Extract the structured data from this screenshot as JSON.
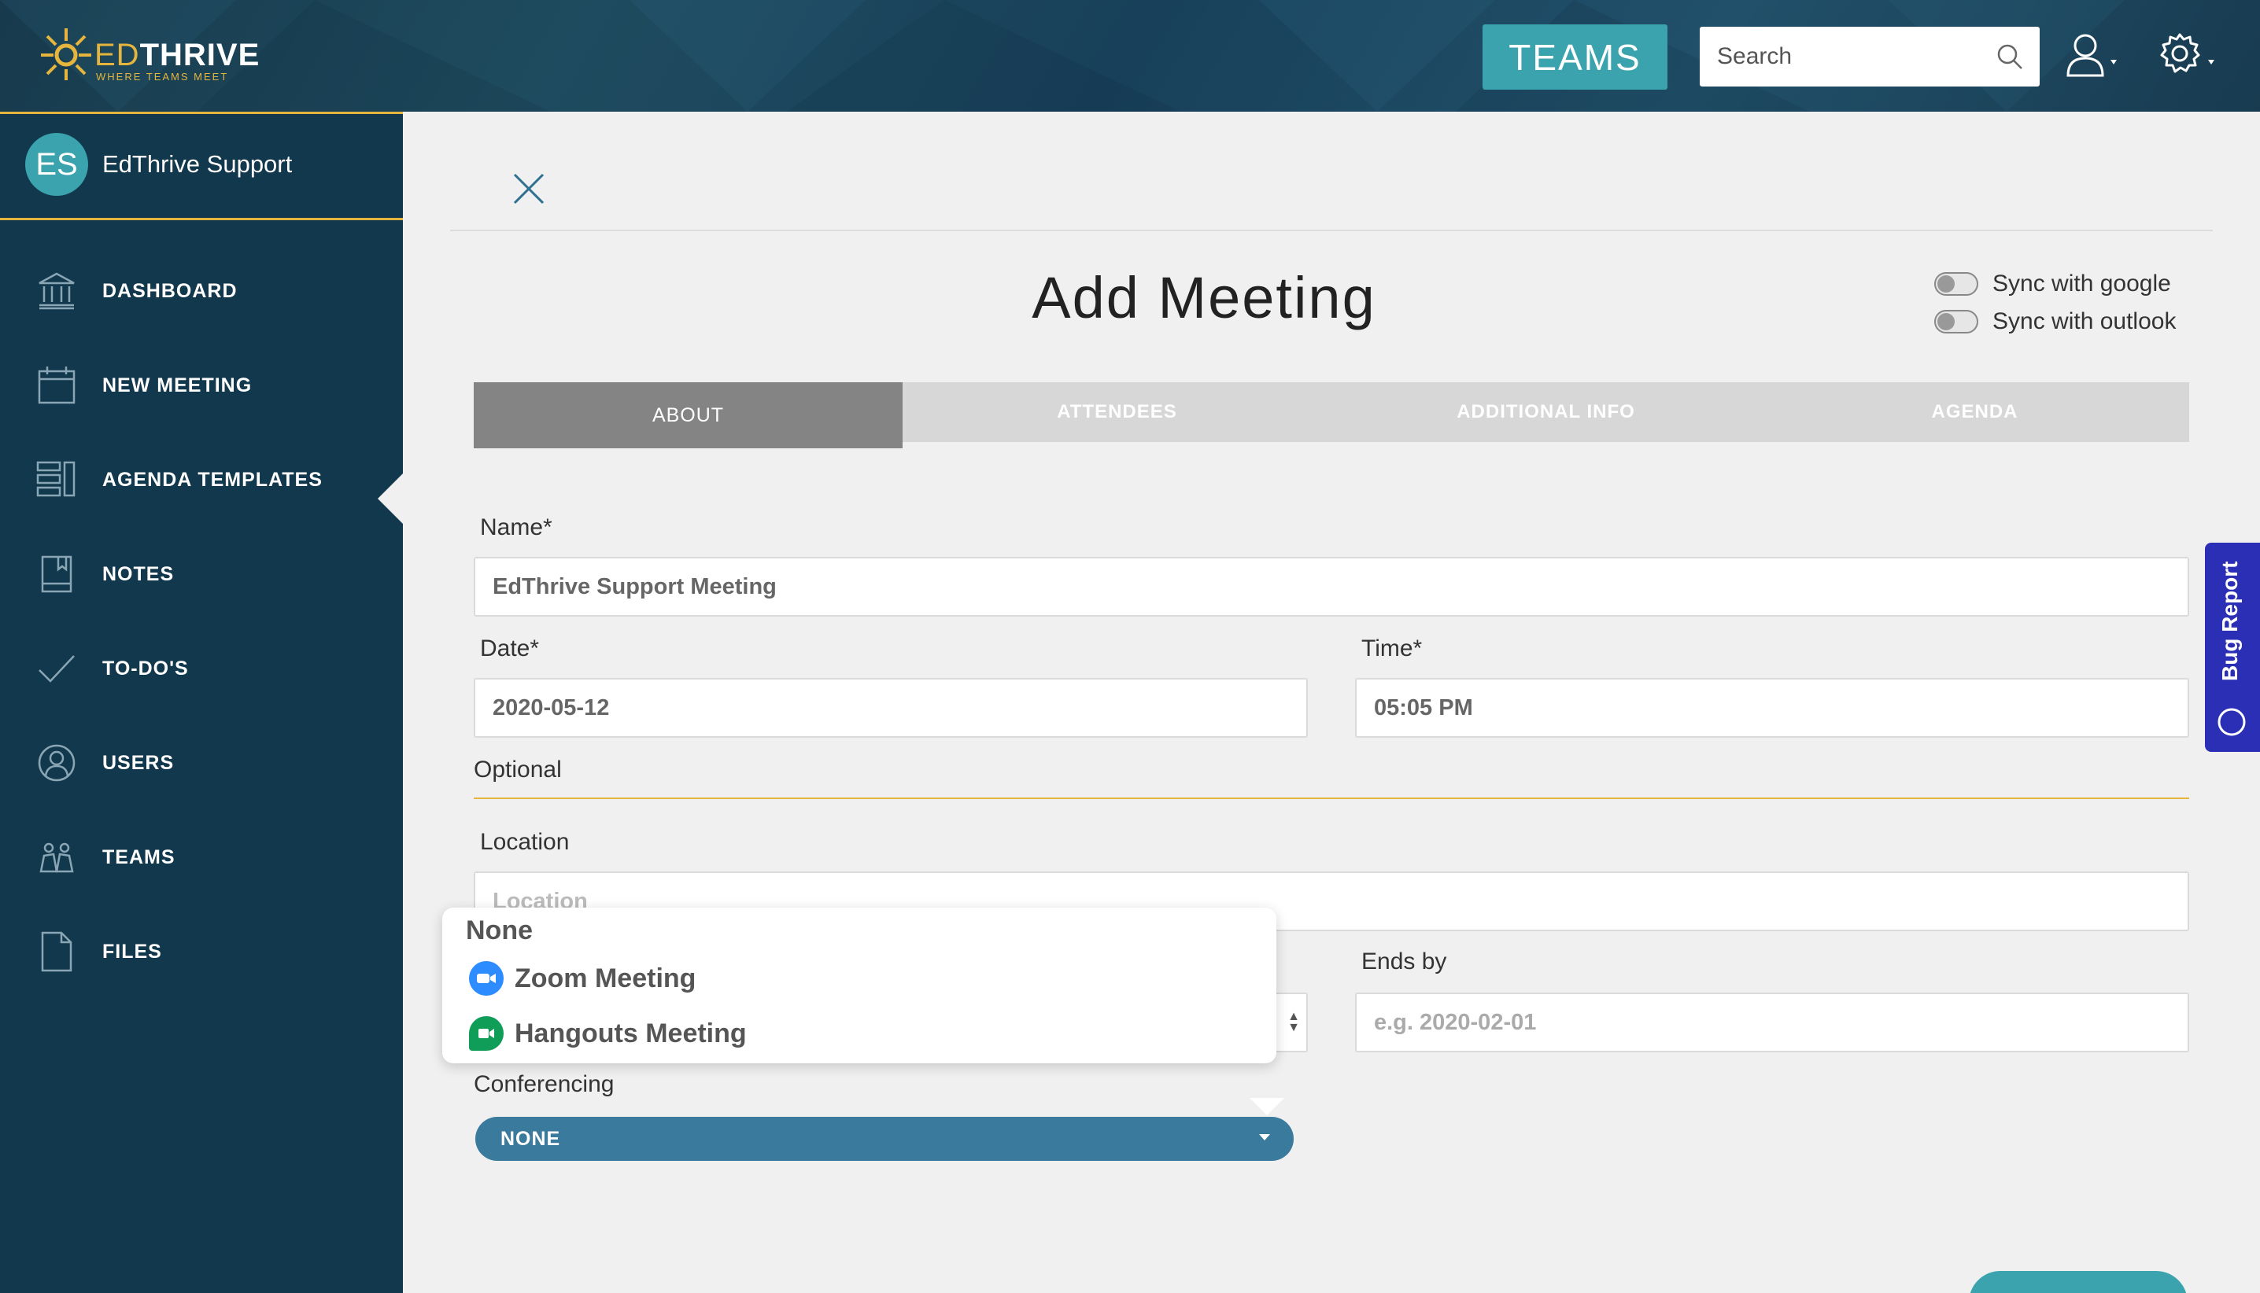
{
  "header": {
    "logo_brand_ed": "ED",
    "logo_brand_thrive": "THRIVE",
    "logo_tagline": "WHERE TEAMS MEET",
    "teams_button": "TEAMS",
    "search_placeholder": "Search"
  },
  "sidebar": {
    "avatar_initials": "ES",
    "profile_name": "EdThrive Support",
    "items": [
      {
        "label": "DASHBOARD",
        "icon": "bank-icon"
      },
      {
        "label": "NEW MEETING",
        "icon": "calendar-icon"
      },
      {
        "label": "AGENDA TEMPLATES",
        "icon": "agenda-icon"
      },
      {
        "label": "NOTES",
        "icon": "notebook-icon"
      },
      {
        "label": "TO-DO'S",
        "icon": "check-icon"
      },
      {
        "label": "USERS",
        "icon": "user-circle-icon"
      },
      {
        "label": "TEAMS",
        "icon": "teams-icon"
      },
      {
        "label": "FILES",
        "icon": "file-icon"
      }
    ]
  },
  "main": {
    "title": "Add Meeting",
    "sync_google": "Sync with google",
    "sync_outlook": "Sync with outlook",
    "tabs": [
      {
        "label": "ABOUT"
      },
      {
        "label": "ATTENDEES"
      },
      {
        "label": "ADDITIONAL INFO"
      },
      {
        "label": "AGENDA"
      }
    ],
    "name_label": "Name*",
    "name_value": "EdThrive Support Meeting",
    "date_label": "Date*",
    "date_value": "2020-05-12",
    "time_label": "Time*",
    "time_value": "05:05 PM",
    "optional_label": "Optional",
    "location_label": "Location",
    "location_placeholder": "Location",
    "ends_by_label": "Ends by",
    "ends_by_placeholder": "e.g. 2020-02-01",
    "conferencing_label": "Conferencing",
    "conferencing_value": "NONE",
    "dropdown_options": [
      "None",
      "Zoom Meeting",
      "Hangouts Meeting"
    ]
  },
  "bug_report": "Bug Report",
  "colors": {
    "sidebar_bg": "#12384d",
    "accent_teal": "#3aa3ad",
    "accent_gold": "#e5b53d",
    "conf_blue": "#3a7a9c",
    "bug_blue": "#2b2fb5",
    "zoom_blue": "#2d8cff",
    "hangouts_green": "#0f9d58"
  }
}
